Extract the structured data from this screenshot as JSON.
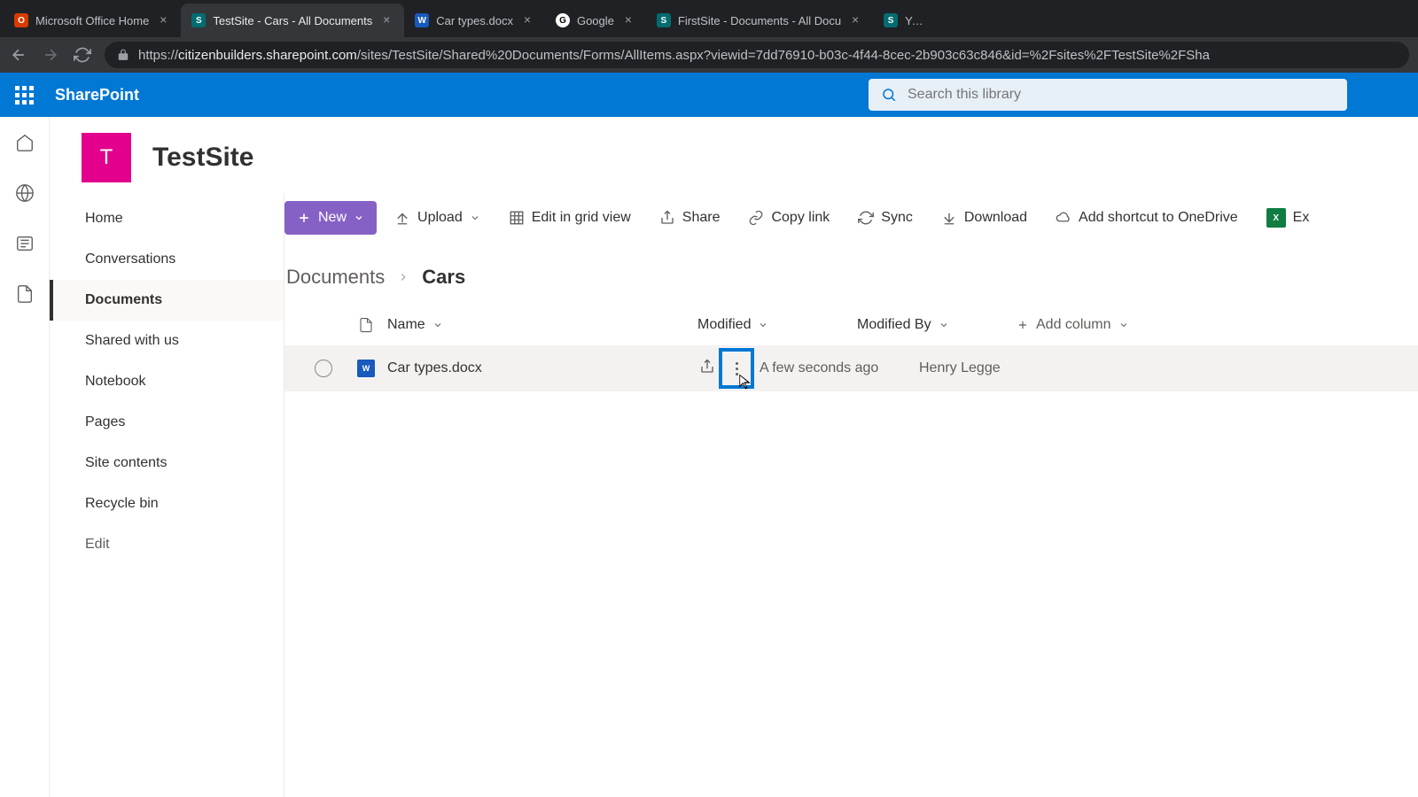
{
  "browser": {
    "tabs": [
      {
        "label": "Microsoft Office Home"
      },
      {
        "label": "TestSite - Cars - All Documents"
      },
      {
        "label": "Car types.docx"
      },
      {
        "label": "Google"
      },
      {
        "label": "FirstSite - Documents - All Docu"
      },
      {
        "label": "Your"
      }
    ],
    "url_prefix": "https://",
    "url_host": "citizenbuilders.sharepoint.com",
    "url_path": "/sites/TestSite/Shared%20Documents/Forms/AllItems.aspx?viewid=7dd76910-b03c-4f44-8cec-2b903c63c846&id=%2Fsites%2FTestSite%2FSha"
  },
  "suite": {
    "brand": "SharePoint",
    "search_placeholder": "Search this library"
  },
  "site": {
    "logo_letter": "T",
    "title": "TestSite"
  },
  "leftnav": {
    "items": [
      {
        "label": "Home"
      },
      {
        "label": "Conversations"
      },
      {
        "label": "Documents"
      },
      {
        "label": "Shared with us"
      },
      {
        "label": "Notebook"
      },
      {
        "label": "Pages"
      },
      {
        "label": "Site contents"
      },
      {
        "label": "Recycle bin"
      },
      {
        "label": "Edit"
      }
    ]
  },
  "cmdbar": {
    "new": "New",
    "upload": "Upload",
    "edit_grid": "Edit in grid view",
    "share": "Share",
    "copy_link": "Copy link",
    "sync": "Sync",
    "download": "Download",
    "shortcut": "Add shortcut to OneDrive",
    "export": "Ex"
  },
  "breadcrumb": {
    "root": "Documents",
    "current": "Cars"
  },
  "columns": {
    "name": "Name",
    "modified": "Modified",
    "modified_by": "Modified By",
    "add": "Add column"
  },
  "rows": [
    {
      "name": "Car types.docx",
      "modified": "A few seconds ago",
      "modified_by": "Henry Legge"
    }
  ]
}
